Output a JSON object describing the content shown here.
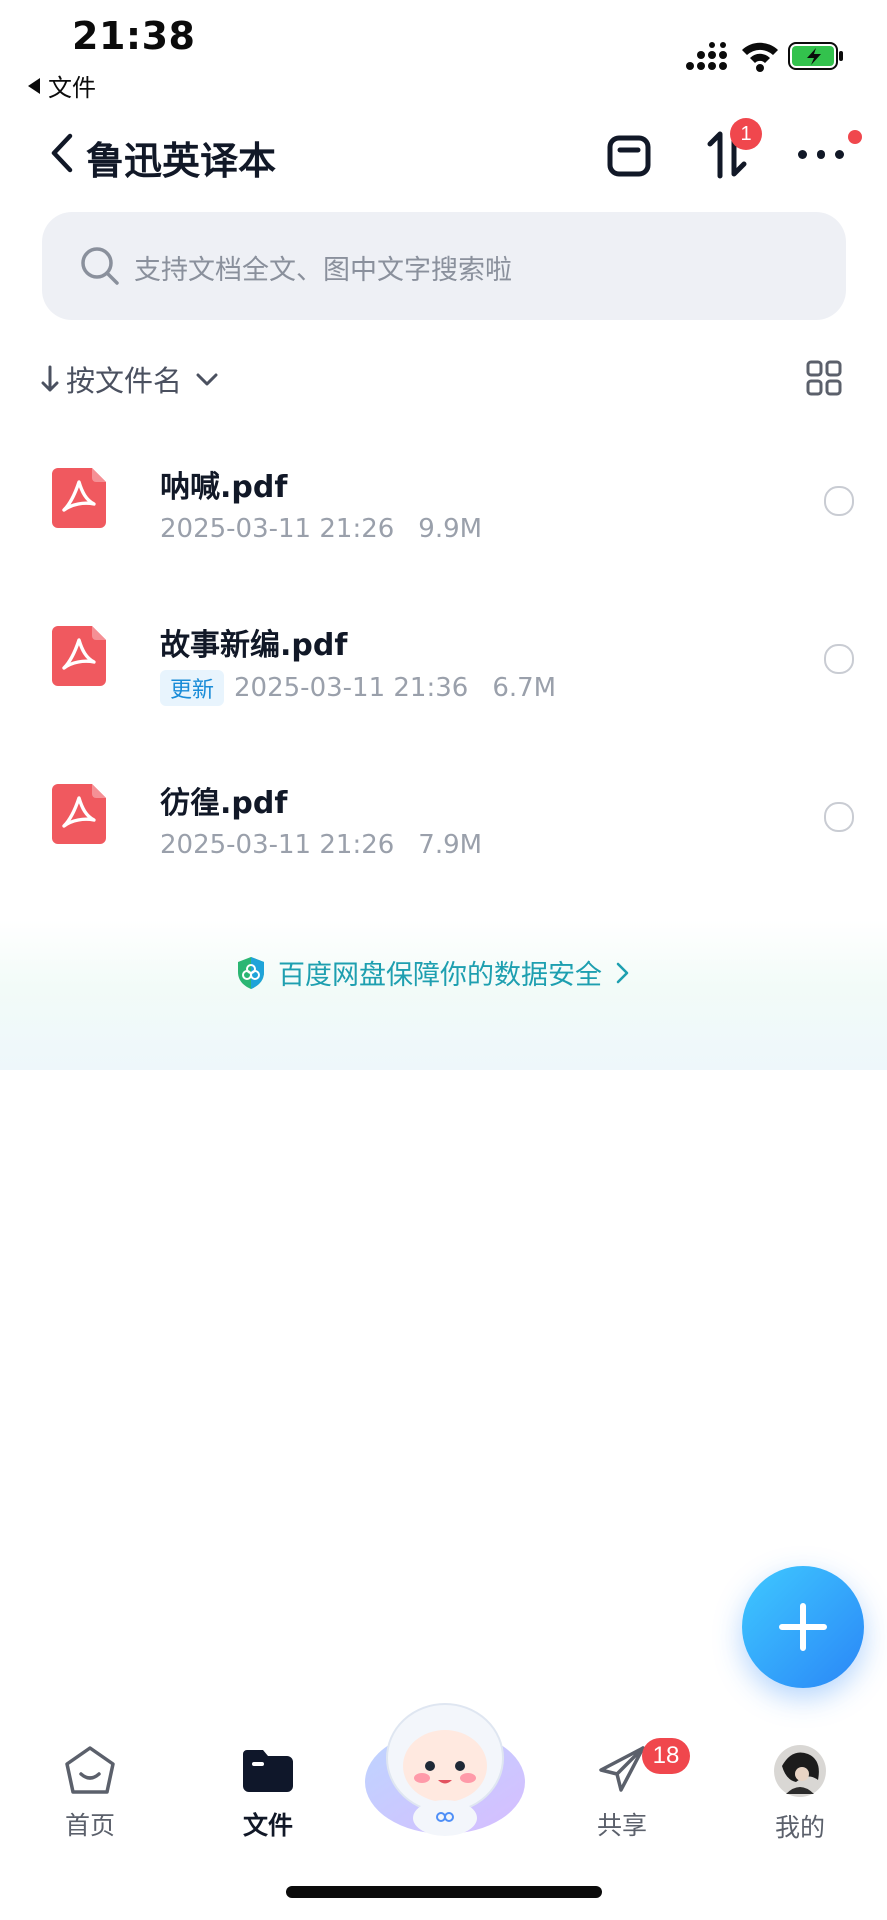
{
  "status_bar": {
    "time": "21:38",
    "back_app": "文件",
    "battery_color": "#33c24d"
  },
  "header": {
    "title": "鲁迅英译本",
    "transfer_badge": "1"
  },
  "search": {
    "placeholder": "支持文档全文、图中文字搜索啦"
  },
  "sort": {
    "label": "按文件名"
  },
  "files": [
    {
      "name": "呐喊.pdf",
      "tag": "",
      "date": "2025-03-11 21:26",
      "size": "9.9M"
    },
    {
      "name": "故事新编.pdf",
      "tag": "更新",
      "date": "2025-03-11 21:36",
      "size": "6.7M"
    },
    {
      "name": "彷徨.pdf",
      "tag": "",
      "date": "2025-03-11 21:26",
      "size": "7.9M"
    }
  ],
  "security": {
    "text": "百度网盘保障你的数据安全"
  },
  "tabbar": {
    "items": [
      {
        "label": "首页"
      },
      {
        "label": "文件"
      },
      {
        "label": ""
      },
      {
        "label": "共享",
        "badge": "18"
      },
      {
        "label": "我的"
      }
    ],
    "active": "文件"
  },
  "colors": {
    "accent": "#2a86f7",
    "badge_red": "#f0474d",
    "pdf_red": "#f0595f",
    "security_teal": "#1e9fb0"
  }
}
